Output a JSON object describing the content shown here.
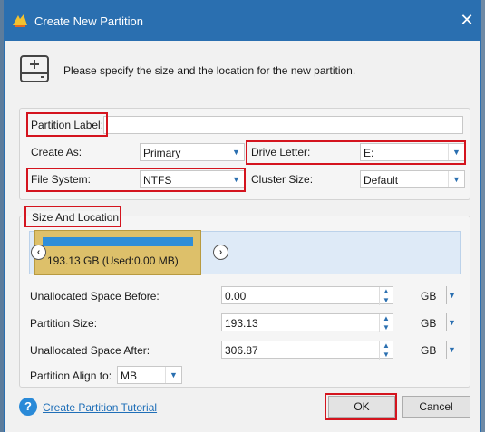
{
  "window": {
    "title": "Create New Partition",
    "close_glyph": "✕"
  },
  "header": {
    "instruction": "Please specify the size and the location for the new partition."
  },
  "form": {
    "partition_label": {
      "label": "Partition Label:",
      "value": ""
    },
    "create_as": {
      "label": "Create As:",
      "value": "Primary"
    },
    "drive_letter": {
      "label": "Drive Letter:",
      "value": "E:"
    },
    "file_system": {
      "label": "File System:",
      "value": "NTFS"
    },
    "cluster_size": {
      "label": "Cluster Size:",
      "value": "Default"
    }
  },
  "size_location": {
    "group_label": "Size And Location",
    "partition_text": "193.13 GB (Used:0.00 MB)",
    "prev_glyph": "‹",
    "next_glyph": "›",
    "unallocated_before": {
      "label": "Unallocated Space Before:",
      "value": "0.00",
      "unit": "GB"
    },
    "partition_size": {
      "label": "Partition Size:",
      "value": "193.13",
      "unit": "GB"
    },
    "unallocated_after": {
      "label": "Unallocated Space After:",
      "value": "306.87",
      "unit": "GB"
    },
    "align": {
      "label": "Partition Align to:",
      "value": "MB"
    }
  },
  "footer": {
    "help_glyph": "?",
    "tutorial_link": "Create Partition Tutorial",
    "ok": "OK",
    "cancel": "Cancel"
  },
  "icons": {
    "dropdown": "chevron-down-icon",
    "spin_up": "▲",
    "spin_down": "▼",
    "arrow": "▼"
  },
  "colors": {
    "titlebar": "#2a6fb0",
    "highlight": "#d4141e",
    "partition": "#ddc06a",
    "used_bar": "#2e8ed8",
    "link": "#1f6fb8"
  }
}
